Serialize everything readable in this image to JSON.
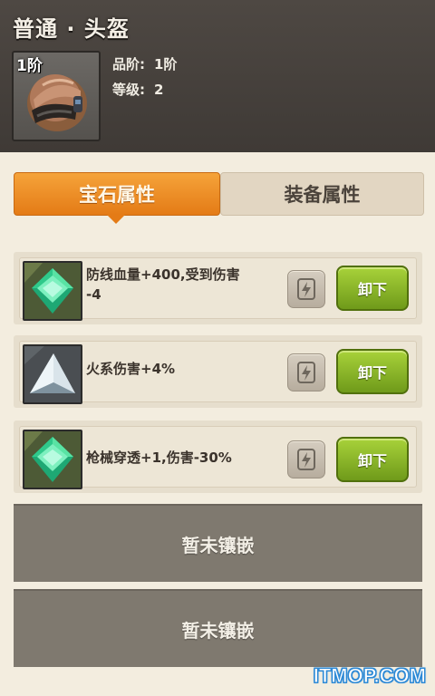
{
  "item": {
    "title": "普通 · 头盔",
    "tier_badge": "1阶",
    "icon": "helmet-icon",
    "quality_label": "品阶:",
    "quality_value": "1阶",
    "level_label": "等级:",
    "level_value": "2"
  },
  "tabs": [
    {
      "label": "宝石属性",
      "active": true
    },
    {
      "label": "装备属性",
      "active": false
    }
  ],
  "gems": [
    {
      "icon": "green-crystal-icon",
      "text_line1": "防线血量+400,受到伤害",
      "text_line2": "-4",
      "swap_icon": "swap-icon",
      "button": "卸下"
    },
    {
      "icon": "white-triangle-crystal-icon",
      "text_line1": "火系伤害+4%",
      "text_line2": "",
      "swap_icon": "swap-icon",
      "button": "卸下"
    },
    {
      "icon": "green-crystal-icon",
      "text_line1": "枪械穿透+1,伤害-30%",
      "text_line2": "",
      "swap_icon": "swap-icon",
      "button": "卸下"
    }
  ],
  "empty_slots": [
    "暂未镶嵌",
    "暂未镶嵌"
  ],
  "watermark": "ITMOP.COM",
  "colors": {
    "active_tab": "#e47b16",
    "unload_button": "#8bb52a",
    "empty_slot": "#7f796f"
  }
}
